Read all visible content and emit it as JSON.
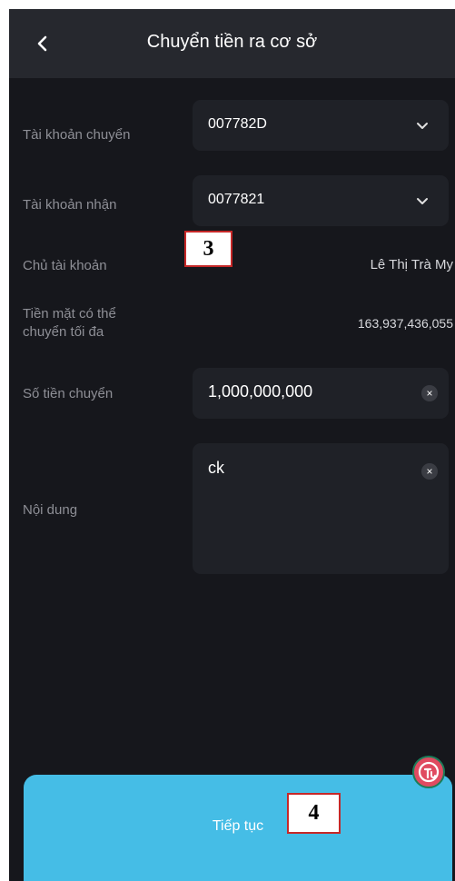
{
  "header": {
    "title": "Chuyển tiền ra cơ sở"
  },
  "form": {
    "from_account": {
      "label": "Tài khoản chuyển",
      "value": "007782D"
    },
    "to_account": {
      "label": "Tài khoản nhận",
      "value": "0077821"
    },
    "owner": {
      "label": "Chủ tài khoản",
      "value": "Lê Thị Trà My"
    },
    "max_cash": {
      "label_line1": "Tiền mặt có thể",
      "label_line2": "chuyển tối đa",
      "value": "163,937,436,055"
    },
    "amount": {
      "label": "Số tiền chuyển",
      "value": "1,000,000,000"
    },
    "content": {
      "label": "Nội dung",
      "value": "ck"
    }
  },
  "actions": {
    "submit_label": "Tiếp tục",
    "clear_glyph": "×"
  },
  "annotations": {
    "marker_3": "3",
    "marker_4": "4"
  },
  "icons": {
    "back": "chevron-left-icon",
    "dropdown": "chevron-down-icon",
    "clear": "close-icon",
    "floating": "app-logo-icon"
  },
  "colors": {
    "background": "#16171c",
    "header": "#26282e",
    "field": "#1f2127",
    "accent": "#45bde6",
    "annotation_border": "#c62828"
  }
}
